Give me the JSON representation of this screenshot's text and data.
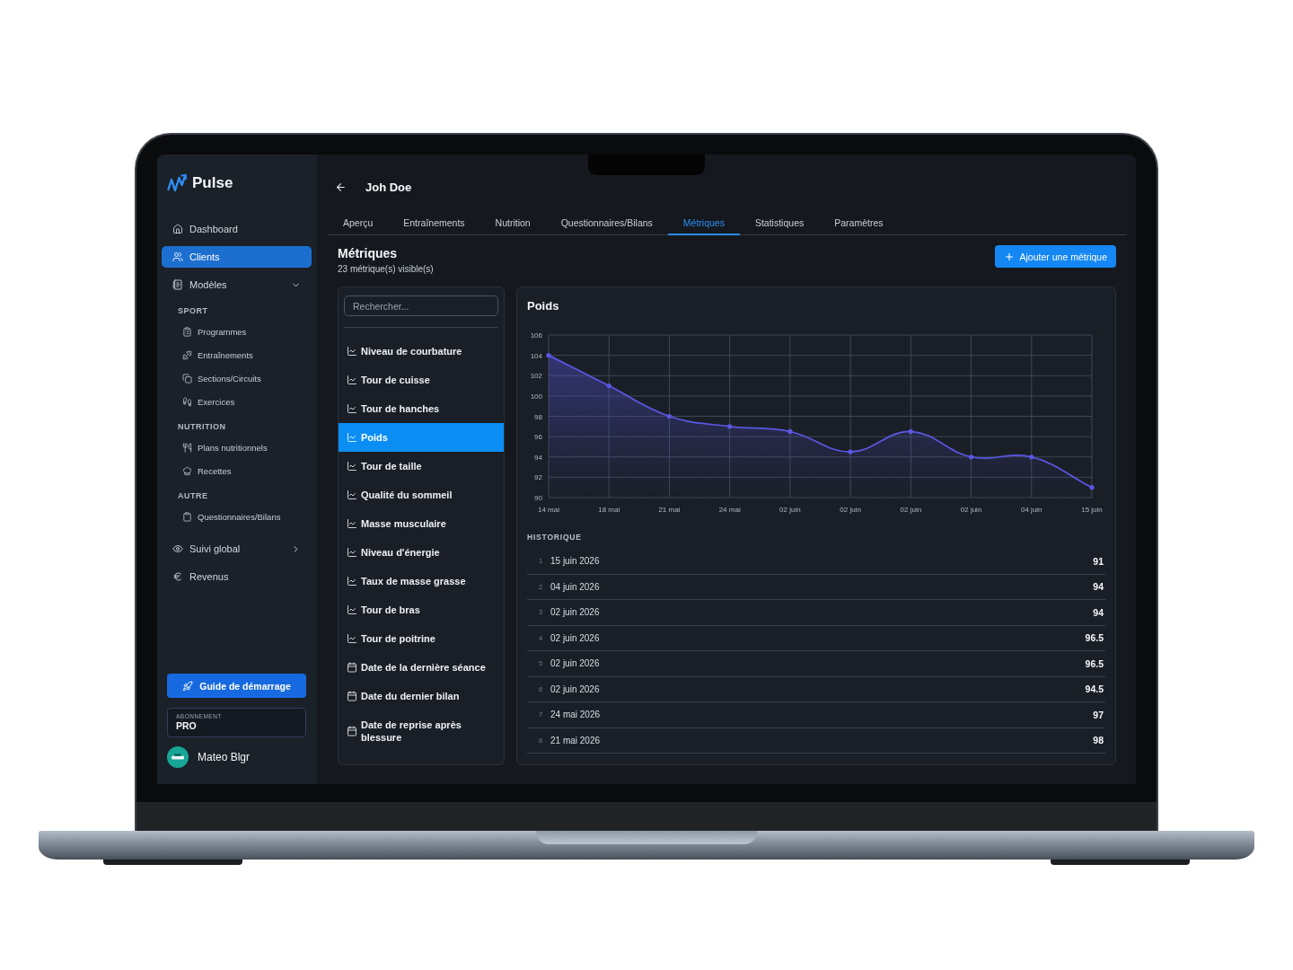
{
  "app": {
    "name": "Pulse"
  },
  "sidebar": {
    "nav": [
      {
        "kind": "link",
        "label": "Dashboard",
        "selected": false
      },
      {
        "kind": "link",
        "label": "Clients",
        "selected": true
      },
      {
        "kind": "group",
        "label": "Modèles",
        "selected": false,
        "expanded": true,
        "sections": [
          {
            "title": "SPORT",
            "items": [
              {
                "label": "Programmes",
                "selected": false
              },
              {
                "label": "Entraînements",
                "selected": false
              },
              {
                "label": "Sections/Circuits",
                "selected": false
              },
              {
                "label": "Exercices",
                "selected": false
              }
            ]
          },
          {
            "title": "NUTRITION",
            "items": [
              {
                "label": "Plans nutritionnels",
                "selected": false
              },
              {
                "label": "Recettes",
                "selected": false
              }
            ]
          },
          {
            "title": "AUTRE",
            "items": [
              {
                "label": "Questionnaires/Bilans",
                "selected": false
              }
            ]
          }
        ]
      },
      {
        "kind": "group",
        "label": "Suivi global",
        "selected": false,
        "expanded": false
      },
      {
        "kind": "link",
        "label": "Revenus",
        "selected": false
      }
    ],
    "guide_button": "Guide de démarrage",
    "subscription": {
      "label": "ABONNEMENT",
      "plan": "PRO"
    },
    "user": {
      "name": "Mateo Blgr"
    }
  },
  "header": {
    "client_name": "Joh Doe",
    "tabs": [
      {
        "label": "Aperçu",
        "selected": false
      },
      {
        "label": "Entraînements",
        "selected": false
      },
      {
        "label": "Nutrition",
        "selected": false
      },
      {
        "label": "Questionnaires/Bilans",
        "selected": false
      },
      {
        "label": "Métriques",
        "selected": true
      },
      {
        "label": "Statistiques",
        "selected": false
      },
      {
        "label": "Paramètres",
        "selected": false
      }
    ]
  },
  "metrics_page": {
    "title": "Métriques",
    "subtitle": "23 métrique(s) visible(s)",
    "add_button": "Ajouter une métrique"
  },
  "metric_list": {
    "search": {
      "placeholder": "Rechercher..."
    },
    "items": [
      {
        "kind": "number",
        "label": "Niveau de courbature",
        "selected": false
      },
      {
        "kind": "number",
        "label": "Tour de cuisse",
        "selected": false
      },
      {
        "kind": "number",
        "label": "Tour de hanches",
        "selected": false
      },
      {
        "kind": "number",
        "label": "Poids",
        "selected": true
      },
      {
        "kind": "number",
        "label": "Tour de taille",
        "selected": false
      },
      {
        "kind": "number",
        "label": "Qualité du sommeil",
        "selected": false
      },
      {
        "kind": "number",
        "label": "Masse musculaire",
        "selected": false
      },
      {
        "kind": "number",
        "label": "Niveau d'énergie",
        "selected": false
      },
      {
        "kind": "number",
        "label": "Taux de masse grasse",
        "selected": false
      },
      {
        "kind": "number",
        "label": "Tour de bras",
        "selected": false
      },
      {
        "kind": "number",
        "label": "Tour de poitrine",
        "selected": false
      },
      {
        "kind": "date",
        "label": "Date de la dernière séance",
        "selected": false
      },
      {
        "kind": "date",
        "label": "Date du dernier bilan",
        "selected": false
      },
      {
        "kind": "date",
        "label": "Date de reprise après blessure",
        "selected": false
      }
    ]
  },
  "detail": {
    "title": "Poids",
    "chart_data": {
      "type": "area",
      "grid": true,
      "categories": [
        "14 mai",
        "18 mai",
        "21 mai",
        "24 mai",
        "02 juin",
        "02 juin",
        "02 juin",
        "02 juin",
        "04 juin",
        "15 juin"
      ],
      "values": [
        104,
        101,
        98,
        97,
        96.5,
        94.5,
        96.5,
        94,
        94,
        91
      ],
      "ylim": [
        90,
        106
      ],
      "yticks": [
        90,
        92,
        94,
        96,
        98,
        100,
        102,
        104,
        106
      ]
    },
    "history": {
      "title": "HISTORIQUE",
      "rows": [
        {
          "index": "1",
          "date": "15 juin 2026",
          "value": "91"
        },
        {
          "index": "2",
          "date": "04 juin 2026",
          "value": "94"
        },
        {
          "index": "3",
          "date": "02 juin 2026",
          "value": "94"
        },
        {
          "index": "4",
          "date": "02 juin 2026",
          "value": "96.5"
        },
        {
          "index": "5",
          "date": "02 juin 2026",
          "value": "96.5"
        },
        {
          "index": "6",
          "date": "02 juin 2026",
          "value": "94.5"
        },
        {
          "index": "7",
          "date": "24 mai 2026",
          "value": "97"
        },
        {
          "index": "8",
          "date": "21 mai 2026",
          "value": "98"
        }
      ]
    }
  }
}
